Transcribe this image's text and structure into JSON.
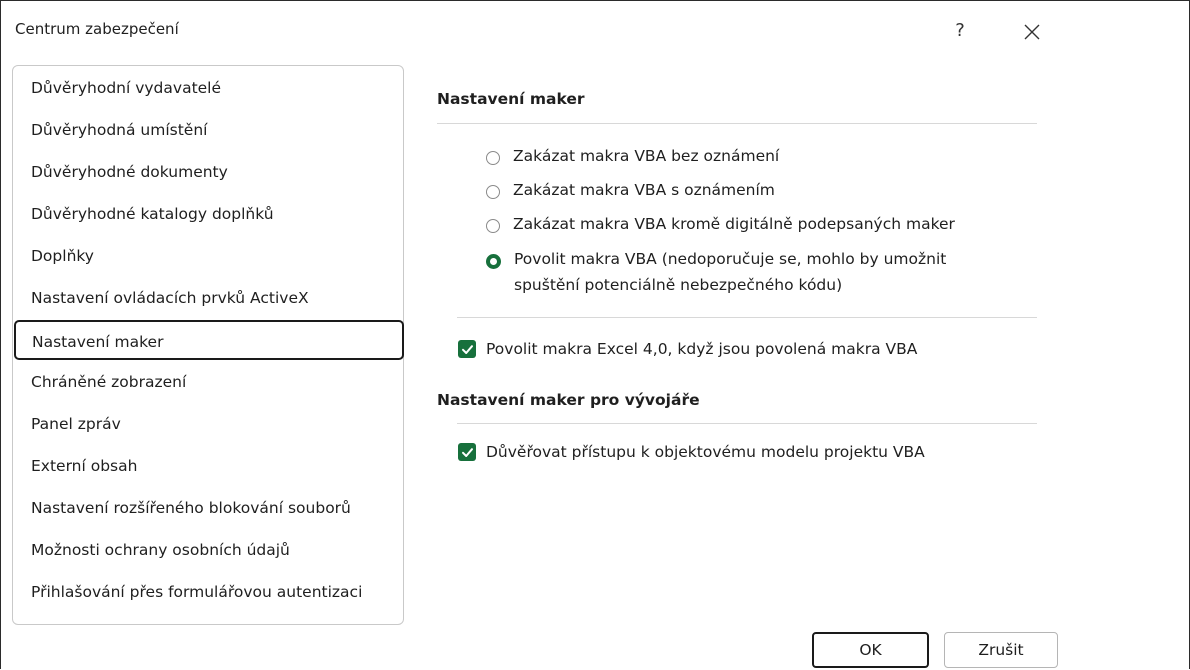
{
  "window": {
    "title": "Centrum zabezpečení",
    "help_label": "?",
    "close_icon": "close-icon"
  },
  "sidebar": {
    "items": [
      {
        "label": "Důvěryhodní vydavatelé",
        "selected": false
      },
      {
        "label": "Důvěryhodná umístění",
        "selected": false
      },
      {
        "label": "Důvěryhodné dokumenty",
        "selected": false
      },
      {
        "label": "Důvěryhodné katalogy doplňků",
        "selected": false
      },
      {
        "label": "Doplňky",
        "selected": false
      },
      {
        "label": "Nastavení ovládacích prvků ActiveX",
        "selected": false
      },
      {
        "label": "Nastavení maker",
        "selected": true
      },
      {
        "label": "Chráněné zobrazení",
        "selected": false
      },
      {
        "label": "Panel zpráv",
        "selected": false
      },
      {
        "label": "Externí obsah",
        "selected": false
      },
      {
        "label": "Nastavení rozšířeného blokování souborů",
        "selected": false
      },
      {
        "label": "Možnosti ochrany osobních údajů",
        "selected": false
      },
      {
        "label": "Přihlašování přes formulářovou autentizaci",
        "selected": false
      }
    ]
  },
  "macro_settings": {
    "title": "Nastavení maker",
    "options": [
      {
        "label": "Zakázat makra VBA bez oznámení",
        "selected": false
      },
      {
        "label": "Zakázat makra VBA s oznámením",
        "selected": false
      },
      {
        "label": "Zakázat makra VBA kromě digitálně podepsaných maker",
        "selected": false
      },
      {
        "label_line1": "Povolit makra VBA (nedoporučuje se, mohlo by umožnit",
        "label_line2": "spuštění potenciálně nebezpečného kódu)",
        "selected": true
      }
    ],
    "excel4_checkbox": {
      "label": "Povolit makra Excel 4,0, když jsou povolená makra VBA",
      "checked": true
    }
  },
  "developer_settings": {
    "title": "Nastavení maker pro vývojáře",
    "vba_access_checkbox": {
      "label": "Důvěřovat přístupu k objektovému modelu projektu VBA",
      "checked": true
    }
  },
  "buttons": {
    "ok_label": "OK",
    "cancel_label": "Zrušit"
  },
  "colors": {
    "accent_green": "#17703c",
    "selection_border": "#1a1a1a"
  }
}
